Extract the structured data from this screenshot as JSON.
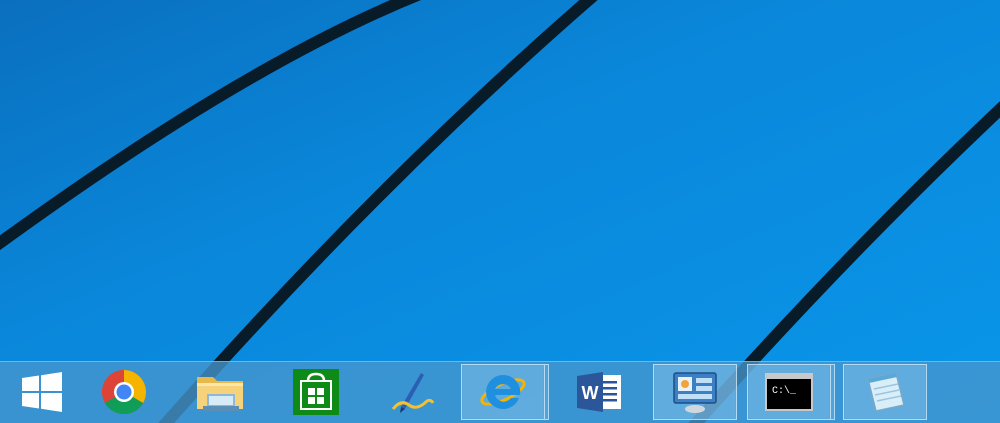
{
  "wallpaper": {
    "base_color": "#0a8fe2",
    "line_color": "#061a2a"
  },
  "taskbar": {
    "background": "#4696cd",
    "items": [
      {
        "id": "start",
        "icon": "windows-logo-icon",
        "running": false
      },
      {
        "id": "chrome",
        "icon": "chrome-icon",
        "running": false
      },
      {
        "id": "file-explorer",
        "icon": "folder-icon",
        "running": false
      },
      {
        "id": "store",
        "icon": "store-bag-icon",
        "running": false
      },
      {
        "id": "journal",
        "icon": "pen-icon",
        "running": false
      },
      {
        "id": "internet-explorer",
        "icon": "internet-explorer-icon",
        "running": true
      },
      {
        "id": "word",
        "icon": "word-icon",
        "running": false
      },
      {
        "id": "control-panel",
        "icon": "control-panel-icon",
        "running": true
      },
      {
        "id": "command-prompt",
        "icon": "command-prompt-icon",
        "running": true
      },
      {
        "id": "notepad",
        "icon": "notepad-icon",
        "running": true
      }
    ],
    "cmd_prompt_glyph": "C:\\_",
    "word_glyph": "W"
  }
}
